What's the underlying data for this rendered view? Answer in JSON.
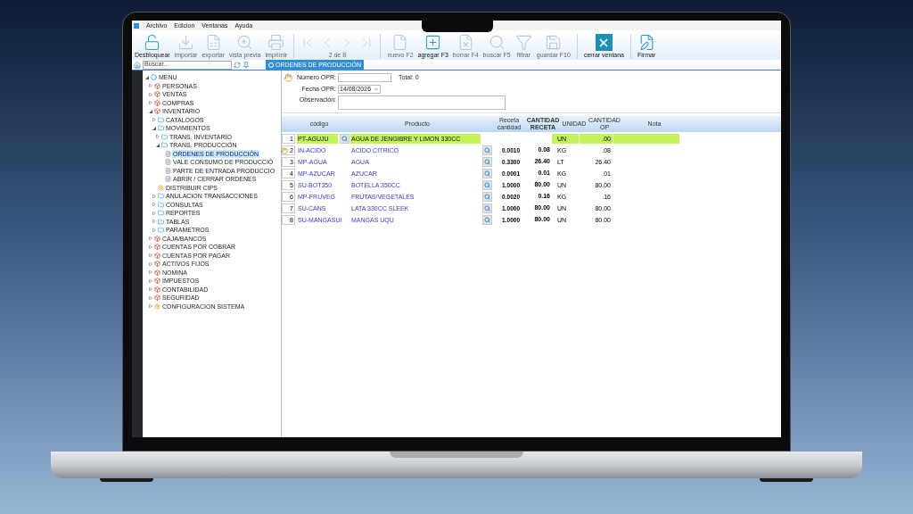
{
  "menu": [
    "Archivo",
    "Edicion",
    "Ventanas",
    "Ayuda"
  ],
  "toolbar": [
    {
      "kind": "unlock",
      "label": "Desbloquear",
      "disabled": false
    },
    {
      "kind": "import",
      "label": "importar",
      "disabled": true
    },
    {
      "kind": "export",
      "label": "exportar",
      "disabled": true
    },
    {
      "kind": "preview",
      "label": "vista previa",
      "disabled": true
    },
    {
      "kind": "print",
      "label": "imprimir",
      "disabled": true
    },
    {
      "kind": "nav",
      "label": "2 de 8",
      "disabled": true
    },
    {
      "kind": "new",
      "label": "nuevo F2",
      "disabled": true
    },
    {
      "kind": "add",
      "label": "agregar F3",
      "disabled": false
    },
    {
      "kind": "delete",
      "label": "borrar F4",
      "disabled": true
    },
    {
      "kind": "find",
      "label": "buscar F5",
      "disabled": true
    },
    {
      "kind": "filter",
      "label": "filtrar",
      "disabled": true
    },
    {
      "kind": "save",
      "label": "guardar F10",
      "disabled": true
    },
    {
      "kind": "close",
      "label": "cerrar ventana",
      "disabled": false
    },
    {
      "kind": "sign",
      "label": "Firmar",
      "disabled": false
    }
  ],
  "search": {
    "placeholder": "Buscar..."
  },
  "tabs": [
    {
      "label": "ORDENES DE PRODUCCIÓN",
      "selected": true
    }
  ],
  "tree": [
    {
      "label": "MENU",
      "kind": "menu",
      "expanded": true,
      "selected": false,
      "children": [
        {
          "label": "PERSONAS",
          "kind": "module",
          "expanded": false,
          "selected": false
        },
        {
          "label": "VENTAS",
          "kind": "module",
          "expanded": false,
          "selected": false
        },
        {
          "label": "COMPRAS",
          "kind": "module",
          "expanded": false,
          "selected": false
        },
        {
          "label": "INVENTARIO",
          "kind": "module",
          "expanded": true,
          "selected": false,
          "children": [
            {
              "label": "CATALOGOS",
              "kind": "folder",
              "expanded": false,
              "selected": false
            },
            {
              "label": "MOVIMIENTOS",
              "kind": "folder",
              "expanded": true,
              "selected": false,
              "children": [
                {
                  "label": "TRANS. INVENTARIO",
                  "kind": "folder",
                  "expanded": false,
                  "selected": false
                },
                {
                  "label": "TRANS. PRODUCCIÓN",
                  "kind": "folder",
                  "expanded": true,
                  "selected": false,
                  "children": [
                    {
                      "label": "ORDENES DE PRODUCCIÓN",
                      "kind": "doc",
                      "selected": true
                    },
                    {
                      "label": "VALE CONSUMO DE PRODUCCIÓ",
                      "kind": "doc",
                      "selected": false
                    },
                    {
                      "label": "PARTE DE ENTRADA PRODUCCIO",
                      "kind": "doc",
                      "selected": false
                    },
                    {
                      "label": "ABRIR / CERRAR ORDENES",
                      "kind": "doc",
                      "selected": false
                    }
                  ]
                }
              ]
            },
            {
              "label": "DISTRIBUIR CIPS",
              "kind": "special",
              "selected": false
            },
            {
              "label": "ANULACION TRANSACCIONES",
              "kind": "folder",
              "expanded": false,
              "selected": false
            },
            {
              "label": "CONSULTAS",
              "kind": "folder",
              "expanded": false,
              "selected": false
            },
            {
              "label": "REPORTES",
              "kind": "folder",
              "expanded": false,
              "selected": false
            },
            {
              "label": "TABLAS",
              "kind": "folder",
              "expanded": false,
              "selected": false
            },
            {
              "label": "PARAMETROS",
              "kind": "folder",
              "expanded": false,
              "selected": false
            }
          ]
        },
        {
          "label": "CAJA/BANCOS",
          "kind": "module",
          "expanded": false,
          "selected": false
        },
        {
          "label": "CUENTAS POR COBRAR",
          "kind": "module",
          "expanded": false,
          "selected": false
        },
        {
          "label": "CUENTAS POR PAGAR",
          "kind": "module",
          "expanded": false,
          "selected": false
        },
        {
          "label": "ACTIVOS FIJOS",
          "kind": "module",
          "expanded": false,
          "selected": false
        },
        {
          "label": "NOMINA",
          "kind": "module",
          "expanded": false,
          "selected": false
        },
        {
          "label": "IMPUESTOS",
          "kind": "module",
          "expanded": false,
          "selected": false
        },
        {
          "label": "CONTABILIDAD",
          "kind": "module",
          "expanded": false,
          "selected": false
        },
        {
          "label": "SEGURIDAD",
          "kind": "module",
          "expanded": false,
          "selected": false
        },
        {
          "label": "CONFIGURACION SISTEMA",
          "kind": "special",
          "expanded": false,
          "selected": false
        }
      ]
    }
  ],
  "form": {
    "numero_label": "Número OPR:",
    "total": "Total: 0",
    "fecha_label": "Fecha OPR:",
    "fecha": "14/08/2026",
    "observacion_label": "Observación:"
  },
  "table": {
    "columns": [
      "código",
      "Producto",
      "Receta cantidad",
      "CANTIDAD RECETA",
      "UNIDAD",
      "CANTIDAD OP",
      "Nota"
    ],
    "rows": [
      {
        "kind": "product",
        "current": false,
        "num": "1",
        "code": "PT-AGUJU",
        "product": "AGUA DE JENGIBRE Y LIMON 330CC",
        "receta": "",
        "cantidad": "",
        "unidad": "UN",
        "op": ".00"
      },
      {
        "kind": "component",
        "current": true,
        "num": "2",
        "code": "IN-ACIDO",
        "product": "ACIDO CITRICO",
        "receta": "0.0010",
        "cantidad": "0.08",
        "unidad": "KG",
        "op": ".08"
      },
      {
        "kind": "component",
        "current": false,
        "num": "3",
        "code": "MP-AGUA",
        "product": "AGUA",
        "receta": "0.3300",
        "cantidad": "26.40",
        "unidad": "LT",
        "op": "26.40"
      },
      {
        "kind": "component",
        "current": false,
        "num": "4",
        "code": "MP-AZUCAR",
        "product": "AZUCAR",
        "receta": "0.0001",
        "cantidad": "0.01",
        "unidad": "KG",
        "op": ".01"
      },
      {
        "kind": "component",
        "current": false,
        "num": "5",
        "code": "SU-BOT350",
        "product": "BOTELLA 350CC",
        "receta": "1.0000",
        "cantidad": "80.00",
        "unidad": "UN",
        "op": "80.00"
      },
      {
        "kind": "component",
        "current": false,
        "num": "6",
        "code": "MP-FRUVEG",
        "product": "FRUTAS/VEGETALES",
        "receta": "0.0020",
        "cantidad": "0.16",
        "unidad": "KG",
        "op": ".16"
      },
      {
        "kind": "component",
        "current": false,
        "num": "7",
        "code": "SU-CANS",
        "product": "LATA 330CC SLEEK",
        "receta": "1.0000",
        "cantidad": "80.00",
        "unidad": "UN",
        "op": "80.00"
      },
      {
        "kind": "component",
        "current": false,
        "num": "8",
        "code": "SU-MANGASUI",
        "product": "MANGAS UQU",
        "receta": "1.0000",
        "cantidad": "80.00",
        "unidad": "UN",
        "op": "80.00"
      }
    ]
  }
}
